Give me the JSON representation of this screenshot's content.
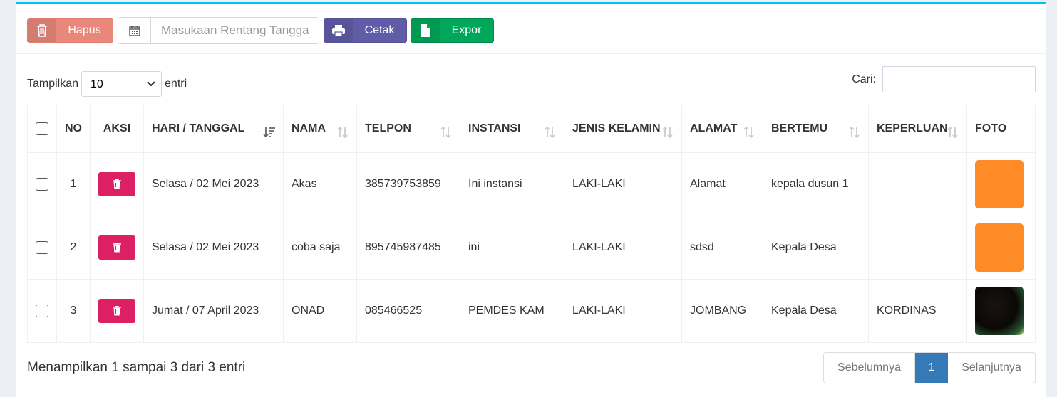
{
  "toolbar": {
    "delete_label": "Hapus",
    "date_placeholder": "Masukaan Rentang Tangga",
    "print_label": "Cetak",
    "export_label": "Expor"
  },
  "length": {
    "prefix": "Tampilkan",
    "selected": "10",
    "suffix": "entri"
  },
  "search": {
    "label": "Cari:",
    "value": ""
  },
  "table": {
    "headers": [
      "NO",
      "AKSI",
      "HARI / TANGGAL",
      "NAMA",
      "TELPON",
      "INSTANSI",
      "JENIS KELAMIN",
      "ALAMAT",
      "BERTEMU",
      "KEPERLUAN",
      "FOTO"
    ],
    "rows": [
      {
        "no": "1",
        "date": "Selasa / 02 Mei 2023",
        "name": "Akas",
        "phone": "385739753859",
        "agency": "Ini instansi",
        "gender": "LAKI-LAKI",
        "address": "Alamat",
        "meet": "kepala dusun 1",
        "purpose": "",
        "photo_color": "#ff8b26"
      },
      {
        "no": "2",
        "date": "Selasa / 02 Mei 2023",
        "name": "coba saja",
        "phone": "895745987485",
        "agency": "ini",
        "gender": "LAKI-LAKI",
        "address": "sdsd",
        "meet": "Kepala Desa",
        "purpose": "",
        "photo_color": "#ff8b26"
      },
      {
        "no": "3",
        "date": "Jumat / 07 April 2023",
        "name": "ONAD",
        "phone": "085466525",
        "agency": "PEMDES KAM",
        "gender": "LAKI-LAKI",
        "address": "JOMBANG",
        "meet": "Kepala Desa",
        "purpose": "KORDINAS",
        "photo_color": "#0a0806"
      }
    ]
  },
  "footer": {
    "info": "Menampilkan 1 sampai 3 dari 3 entri",
    "prev": "Sebelumnya",
    "page": "1",
    "next": "Selanjutnya"
  },
  "colors": {
    "accent": "#00c0ef",
    "danger": "#dd1f64",
    "primary": "#337ab7"
  }
}
